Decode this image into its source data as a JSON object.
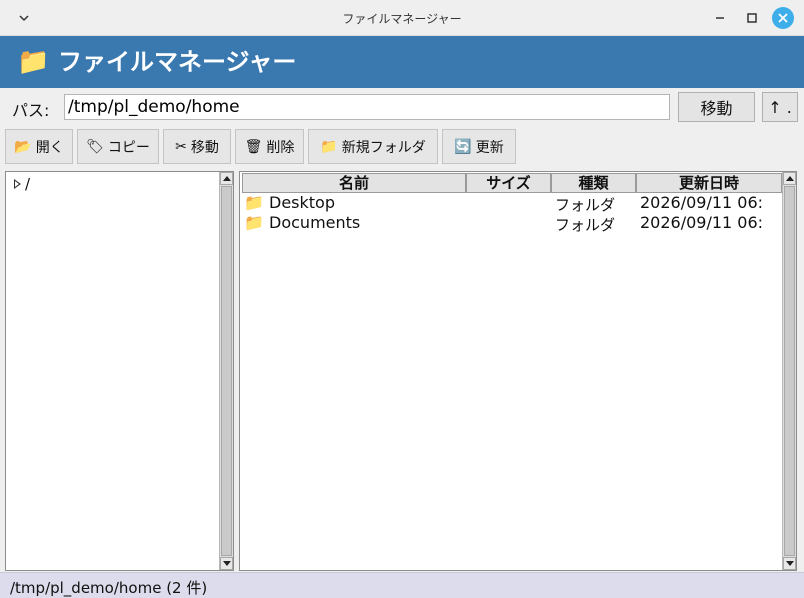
{
  "window": {
    "title": "ファイルマネージャー",
    "accent_color": "#3a78b0",
    "close_color": "#3daee9"
  },
  "header": {
    "icon": "folder-icon",
    "title": "ファイルマネージャー"
  },
  "path_bar": {
    "label": "パス:",
    "value": "/tmp/pl_demo/home",
    "go_label": "移動",
    "up_label": "↑ ."
  },
  "toolbar": [
    {
      "icon": "open-folder-icon",
      "glyph": "📂",
      "label": "開く"
    },
    {
      "icon": "tag-icon",
      "glyph": "🏷",
      "label": "コピー"
    },
    {
      "icon": "scissors-icon",
      "glyph": "✂",
      "label": "移動"
    },
    {
      "icon": "trash-icon",
      "glyph": "🗑",
      "label": "削除"
    },
    {
      "icon": "new-folder-icon",
      "glyph": "📁",
      "label": "新規フォルダ"
    },
    {
      "icon": "refresh-icon",
      "glyph": "🔄",
      "label": "更新"
    }
  ],
  "tree": {
    "root_label": "/"
  },
  "file_list": {
    "columns": [
      "名前",
      "サイズ",
      "種類",
      "更新日時"
    ],
    "rows": [
      {
        "icon": "folder-icon",
        "glyph": "📁",
        "name": "Desktop",
        "size": "",
        "type": "フォルダ",
        "modified": "2026/09/11 06:"
      },
      {
        "icon": "folder-icon",
        "glyph": "📁",
        "name": "Documents",
        "size": "",
        "type": "フォルダ",
        "modified": "2026/09/11 06:"
      }
    ]
  },
  "status": {
    "text": "/tmp/pl_demo/home  (2 件)"
  }
}
